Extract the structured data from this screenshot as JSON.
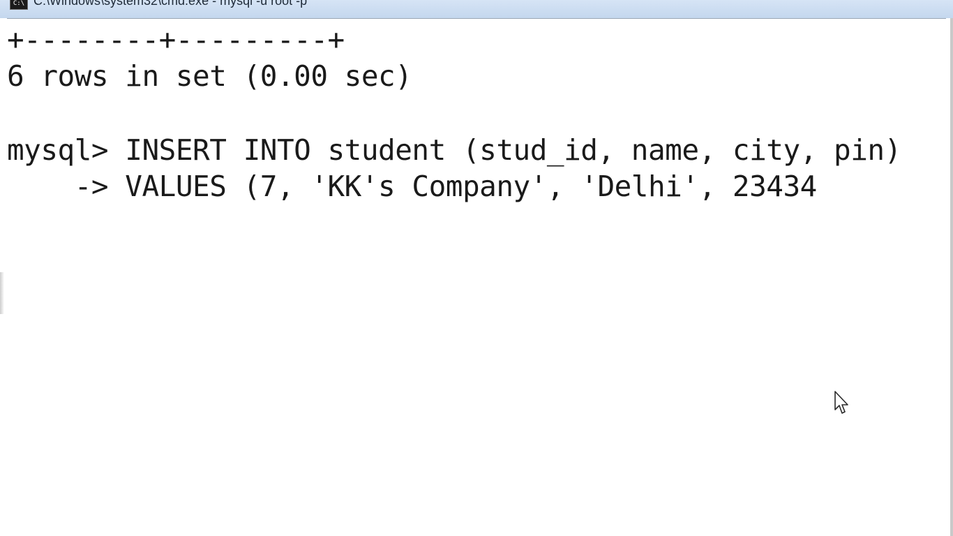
{
  "window": {
    "title": "C:\\Windows\\system32\\cmd.exe - mysql -u root -p",
    "icon": "cmd-icon"
  },
  "console": {
    "lines": [
      "+--------+---------+",
      "6 rows in set (0.00 sec)",
      "",
      "mysql> INSERT INTO student (stud_id, name, city, pin)",
      "    -> VALUES (7, 'KK's Company', 'Delhi', 23434"
    ]
  },
  "colors": {
    "background": "#ffffff",
    "text": "#1a1a1a",
    "titlebar": "#c4d7ee"
  },
  "icons": {
    "mouse": "mouse-pointer-icon"
  }
}
